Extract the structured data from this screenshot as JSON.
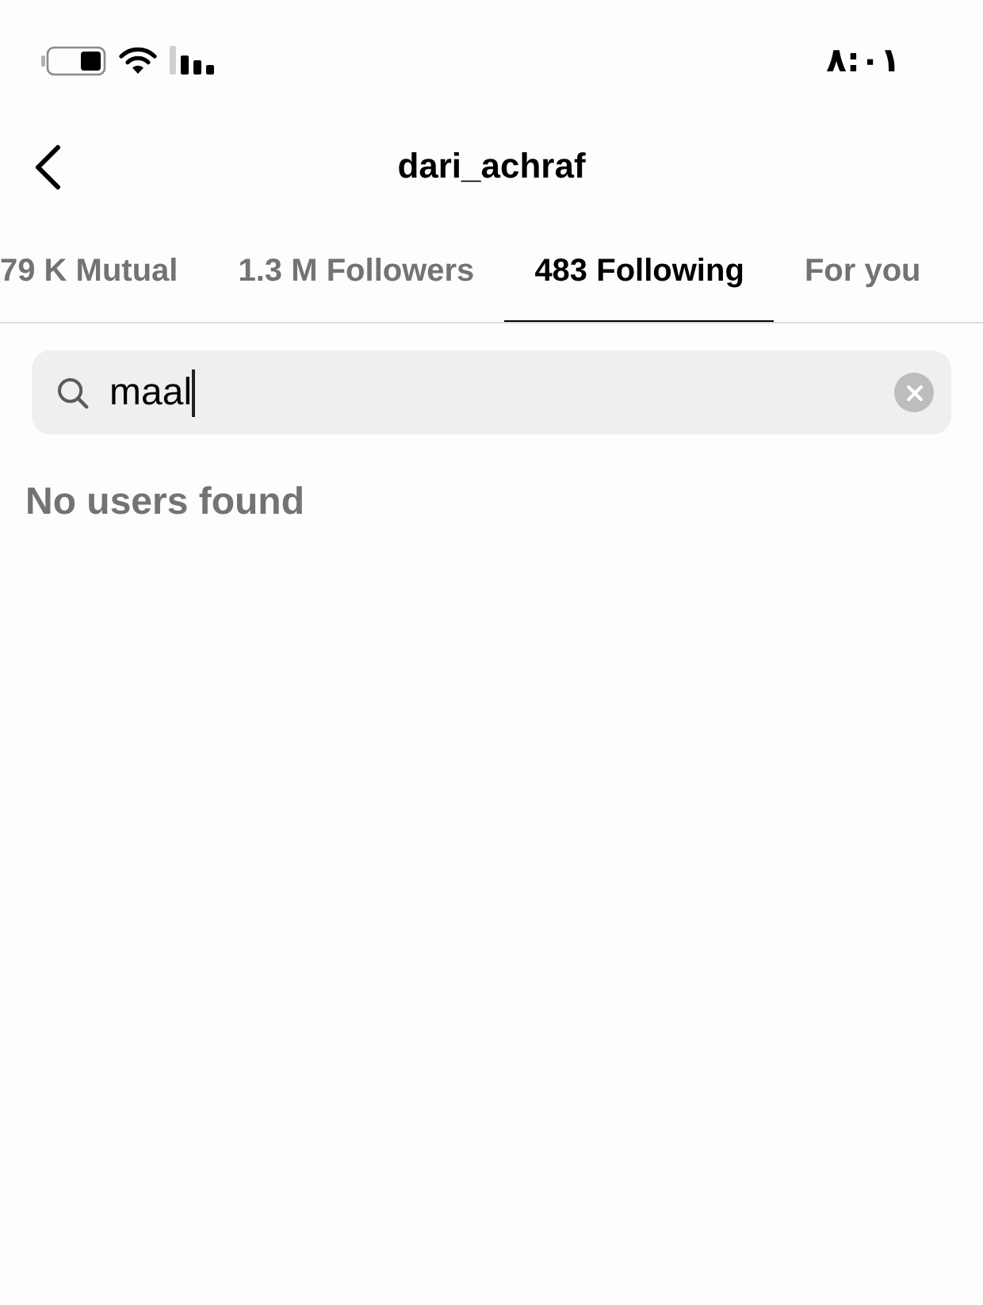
{
  "status_bar": {
    "time": "٨:٠١"
  },
  "header": {
    "title": "dari_achraf"
  },
  "tabs": [
    {
      "label": "79 K Mutual",
      "selected": false
    },
    {
      "label": "1.3 M Followers",
      "selected": false
    },
    {
      "label": "483 Following",
      "selected": true
    },
    {
      "label": "For you",
      "selected": false
    }
  ],
  "search": {
    "value": "maal"
  },
  "empty_message": "No users found"
}
